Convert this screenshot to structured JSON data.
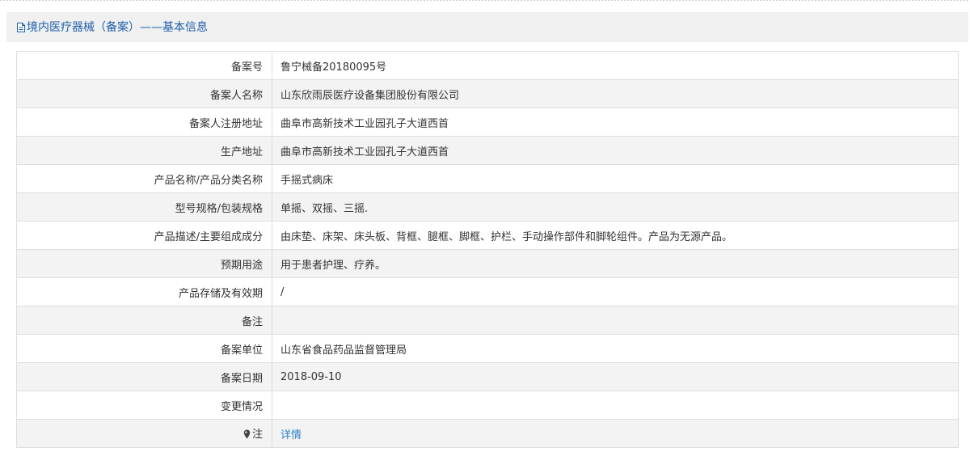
{
  "header": {
    "title": "境内医疗器械（备案）——基本信息",
    "icon": "document-icon"
  },
  "rows": [
    {
      "label": "备案号",
      "value": "鲁宁械备20180095号"
    },
    {
      "label": "备案人名称",
      "value": "山东欣雨辰医疗设备集团股份有限公司"
    },
    {
      "label": "备案人注册地址",
      "value": "曲阜市高新技术工业园孔子大道西首"
    },
    {
      "label": "生产地址",
      "value": "曲阜市高新技术工业园孔子大道西首"
    },
    {
      "label": "产品名称/产品分类名称",
      "value": "手摇式病床"
    },
    {
      "label": "型号规格/包装规格",
      "value": "单摇、双摇、三摇."
    },
    {
      "label": "产品描述/主要组成成分",
      "value": "由床垫、床架、床头板、背框、腿框、脚框、护栏、手动操作部件和脚轮组件。产品为无源产品。"
    },
    {
      "label": "预期用途",
      "value": "用于患者护理、疗养。"
    },
    {
      "label": "产品存储及有效期",
      "value": "/"
    },
    {
      "label": "备注",
      "value": ""
    },
    {
      "label": "备案单位",
      "value": "山东省食品药品监督管理局"
    },
    {
      "label": "备案日期",
      "value": "2018-09-10"
    },
    {
      "label": "变更情况",
      "value": ""
    }
  ],
  "note_row": {
    "label": "注",
    "icon": "pin-icon",
    "link_text": "详情"
  },
  "colors": {
    "header_text": "#1e5faa",
    "link": "#2f82c5",
    "border": "#dedede",
    "stripe": "#f3f3f3",
    "panel_bg": "#f0f0f0"
  }
}
